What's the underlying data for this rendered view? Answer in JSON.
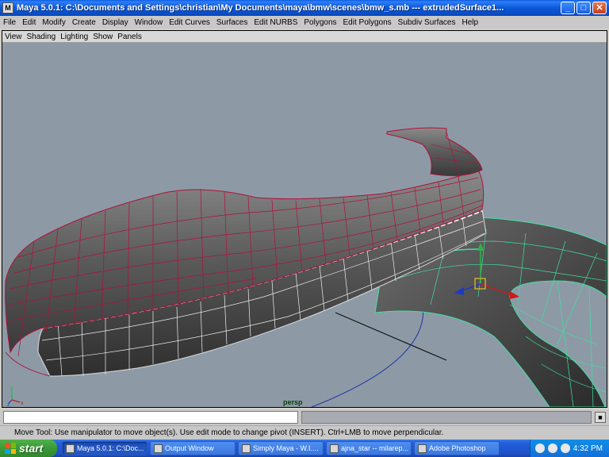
{
  "window": {
    "title": "Maya 5.0.1: C:\\Documents and Settings\\christian\\My Documents\\maya\\bmw\\scenes\\bmw_s.mb   ---   extrudedSurface1...",
    "icon": "maya-icon",
    "buttons": {
      "minimize": "_",
      "maximize": "□",
      "close": "✕"
    }
  },
  "menubar": [
    "File",
    "Edit",
    "Modify",
    "Create",
    "Display",
    "Window",
    "Edit Curves",
    "Surfaces",
    "Edit NURBS",
    "Polygons",
    "Edit Polygons",
    "Subdiv Surfaces",
    "Help"
  ],
  "panel_menu": [
    "View",
    "Shading",
    "Lighting",
    "Show",
    "Panels"
  ],
  "viewport": {
    "camera": "persp",
    "background": "#8d9aa6",
    "wire_red": "#b0103a",
    "wire_green": "#40e0a0",
    "wire_white": "#ffffff"
  },
  "helpline": {
    "text": "Move Tool: Use manipulator to move object(s). Use edit mode to change pivot (INSERT).  Ctrl+LMB to move perpendicular."
  },
  "taskbar": {
    "start": "start",
    "tasks": [
      {
        "label": "Maya 5.0.1: C:\\Doc...",
        "active": true
      },
      {
        "label": "Output Window",
        "active": false
      },
      {
        "label": "Simply Maya - W.I....",
        "active": false
      },
      {
        "label": "ajna_star -- milarep...",
        "active": false
      },
      {
        "label": "Adobe Photoshop",
        "active": false
      }
    ],
    "clock": "4:32 PM"
  }
}
